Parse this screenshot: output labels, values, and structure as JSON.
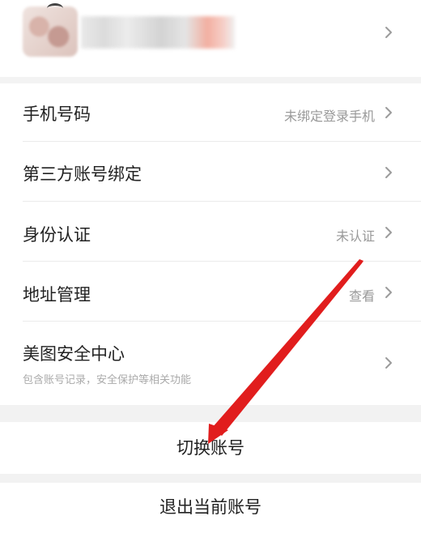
{
  "profile": {
    "avatar_icon": "user-avatar-icon",
    "nickname": ""
  },
  "settings": {
    "items": [
      {
        "label": "手机号码",
        "value": "未绑定登录手机"
      },
      {
        "label": "第三方账号绑定",
        "value": ""
      },
      {
        "label": "身份认证",
        "value": "未认证"
      },
      {
        "label": "地址管理",
        "value": "查看"
      },
      {
        "label": "美图安全中心",
        "value": "",
        "sublabel": "包含账号记录，安全保护等相关功能"
      }
    ]
  },
  "actions": {
    "switch_account": "切换账号",
    "logout": "退出当前账号"
  },
  "colors": {
    "annotation_arrow": "#e11d1d",
    "secondary_text": "#999999",
    "separator": "#ebebeb"
  }
}
